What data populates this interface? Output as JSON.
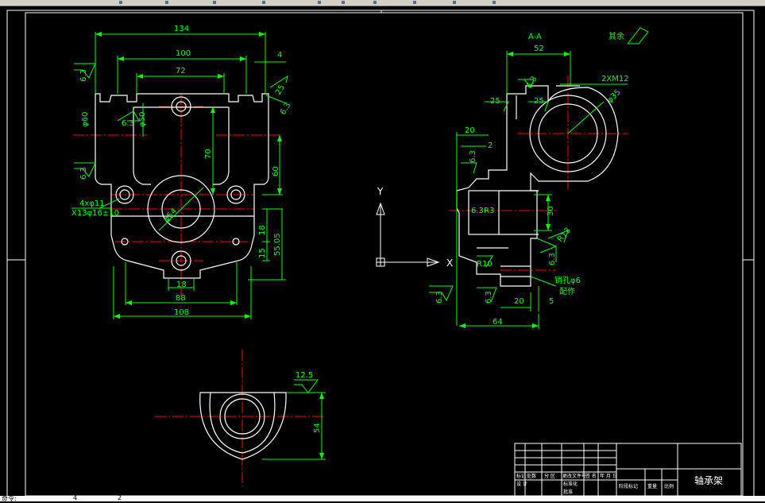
{
  "colors": {
    "background": "#000000",
    "outline": "#ffffff",
    "centerline": "#ff0000",
    "dimension": "#00ff00"
  },
  "front_view": {
    "dims": {
      "d134": "134",
      "d100": "100",
      "d72": "72",
      "d4": "4",
      "d70": "70",
      "d60": "60",
      "d18a": "18",
      "d15": "15",
      "d55": "55.05",
      "d18b": "18",
      "d88": "88",
      "d108": "108",
      "phi60": "φ60",
      "phi50": "φ50",
      "phi54": "φ54",
      "holes_a": "4xφ11",
      "holes_b": "X13φ16±10"
    },
    "roughness": [
      "6.3",
      "6.3",
      "6.3",
      "6.3",
      "25"
    ]
  },
  "section_view": {
    "title": "A-A",
    "rest_note": "其余",
    "dims": {
      "d52": "52",
      "m12": "2XM12",
      "phi35": "φ35",
      "d20a": "20",
      "d2": "2",
      "d30": "30",
      "d20b": "20",
      "d5": "5",
      "d64": "64",
      "r13": "R13",
      "r10": "R10",
      "r3": "R3",
      "pin_note_a": "销孔φ6",
      "pin_note_b": "配作"
    },
    "roughness": [
      "25",
      "25",
      "6.3",
      "6.3",
      "6.3",
      "6.3",
      "6.3",
      "6.3"
    ]
  },
  "bottom_view": {
    "dims": {
      "d54": "54"
    },
    "roughness": [
      "12.5"
    ]
  },
  "ucs": {
    "y_label": "Y",
    "x_label": "X"
  },
  "title_block": {
    "part_name": "轴承架",
    "row_labels": [
      "标记",
      "处数",
      "分 区",
      "更改文件号",
      "签 名",
      "年 月 日"
    ],
    "row2_labels": [
      "设 计"
    ],
    "right_labels": [
      "阶段标记",
      "重量",
      "比例"
    ],
    "small_labels": [
      "标准化",
      "批准"
    ]
  },
  "status": {
    "left": "命令:",
    "mid": "4",
    "right": "2"
  }
}
